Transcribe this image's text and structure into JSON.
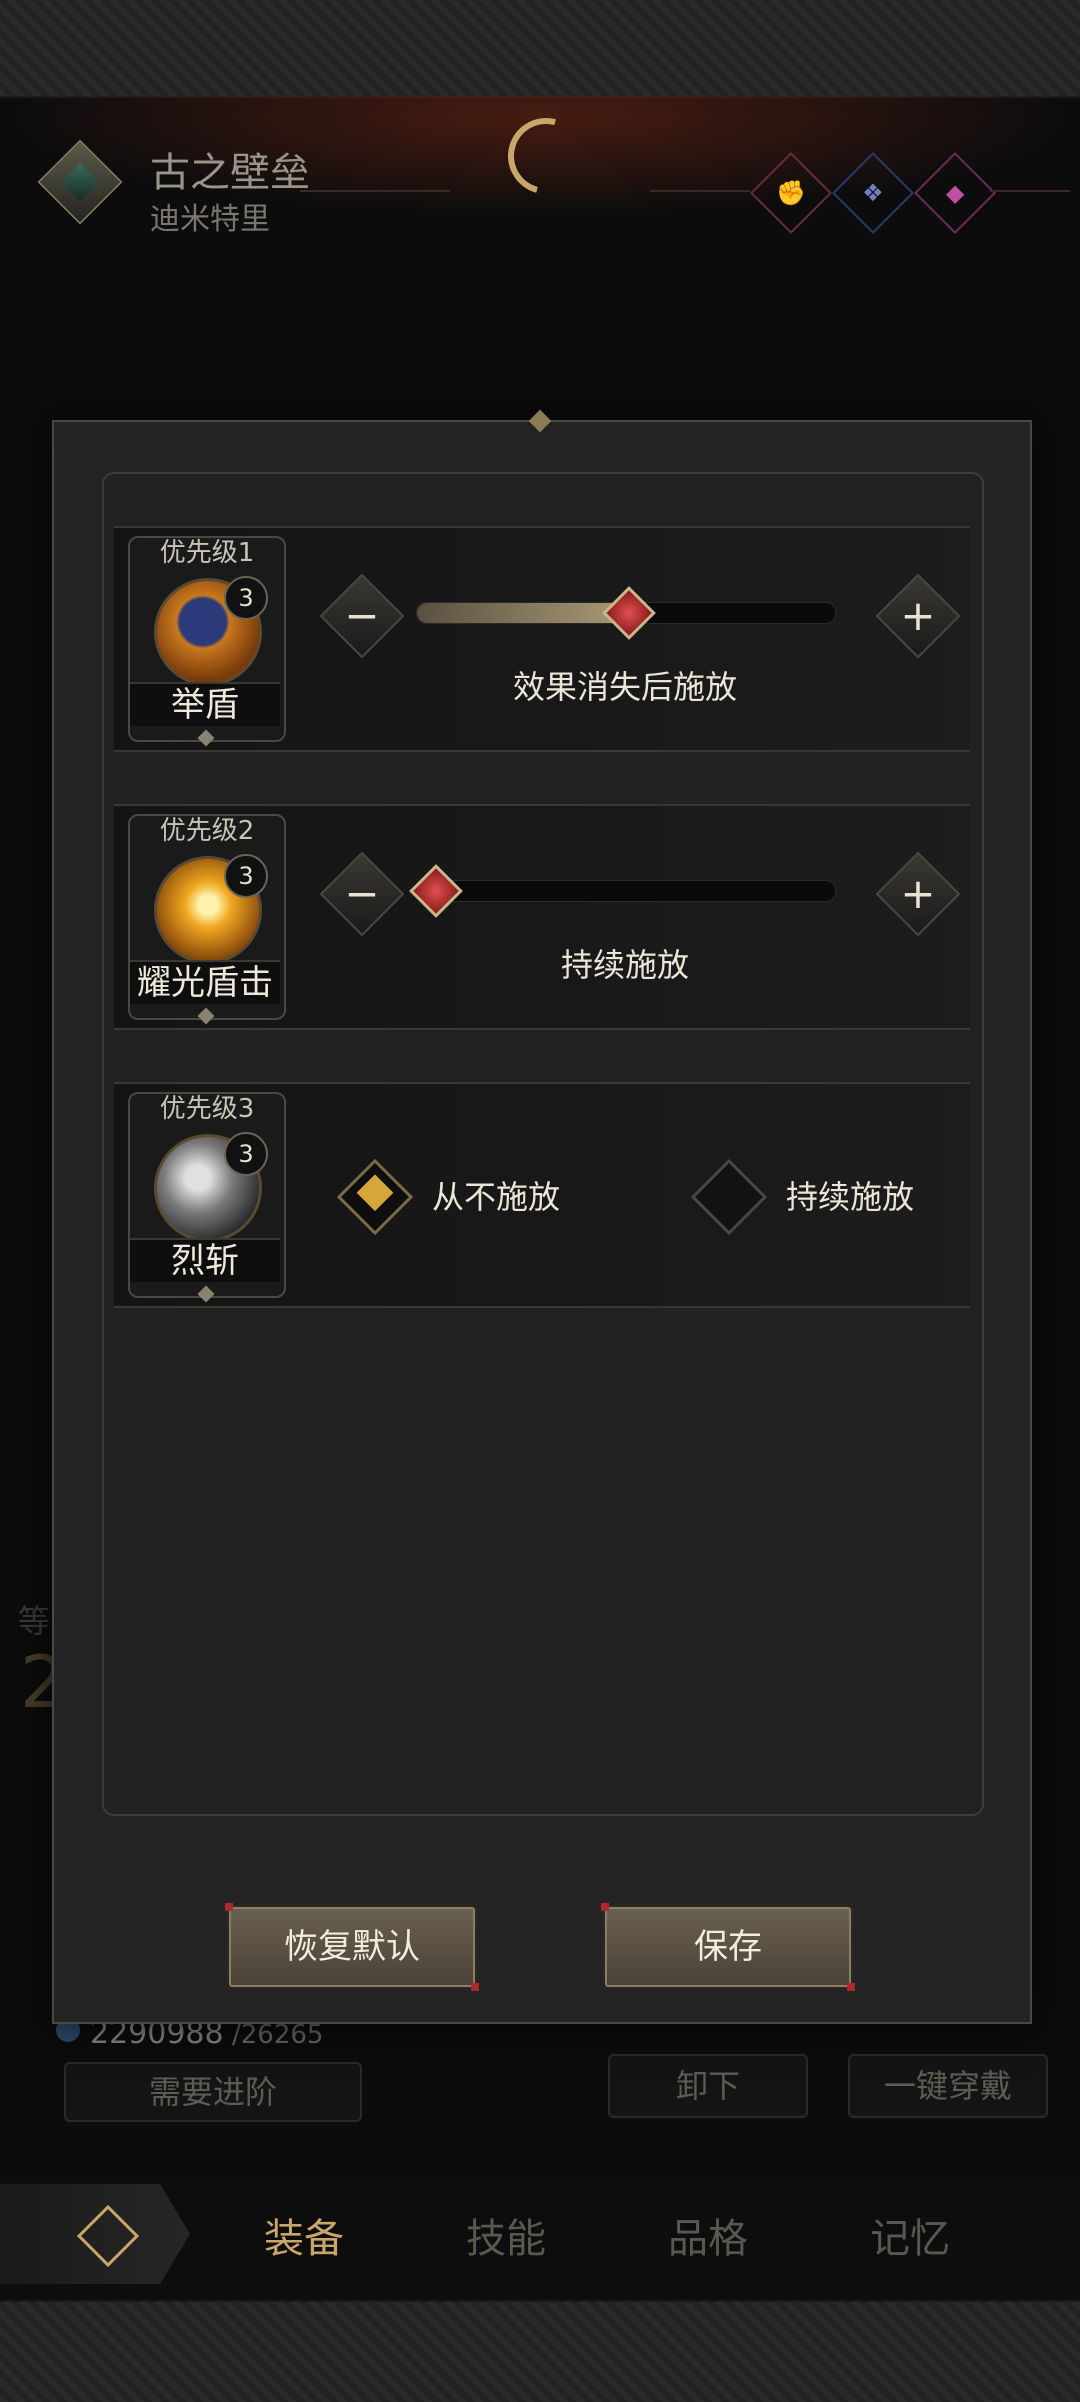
{
  "header": {
    "title": "古之壁垒",
    "subtitle": "迪米特里",
    "class_icons": [
      "fist-icon",
      "beast-icon",
      "shield-crest-icon"
    ]
  },
  "background": {
    "level_label": "等",
    "level_value": "2",
    "exp_text": "2290988",
    "exp_max": "/26265",
    "need_advance": "需要进阶",
    "unequip": "卸下",
    "equip_all": "一键穿戴"
  },
  "modal": {
    "rows": [
      {
        "priority": "优先级1",
        "skill_name": "举盾",
        "level": "3",
        "type": "slider",
        "slider_value": 0.5,
        "mode_text": "效果消失后施放"
      },
      {
        "priority": "优先级2",
        "skill_name": "耀光盾击",
        "level": "3",
        "type": "slider",
        "slider_value": 0.0,
        "mode_text": "持续施放"
      },
      {
        "priority": "优先级3",
        "skill_name": "烈斩",
        "level": "3",
        "type": "radio",
        "options": [
          "从不施放",
          "持续施放"
        ],
        "selected": "从不施放"
      }
    ],
    "buttons": {
      "reset": "恢复默认",
      "save": "保存"
    }
  },
  "bottom_nav": {
    "tabs": [
      "装备",
      "技能",
      "品格",
      "记忆"
    ],
    "active": "装备"
  },
  "colors": {
    "accent_gold": "#c9a66a",
    "radio_selected": "#d8a53a",
    "thumb_red": "#e05050"
  }
}
